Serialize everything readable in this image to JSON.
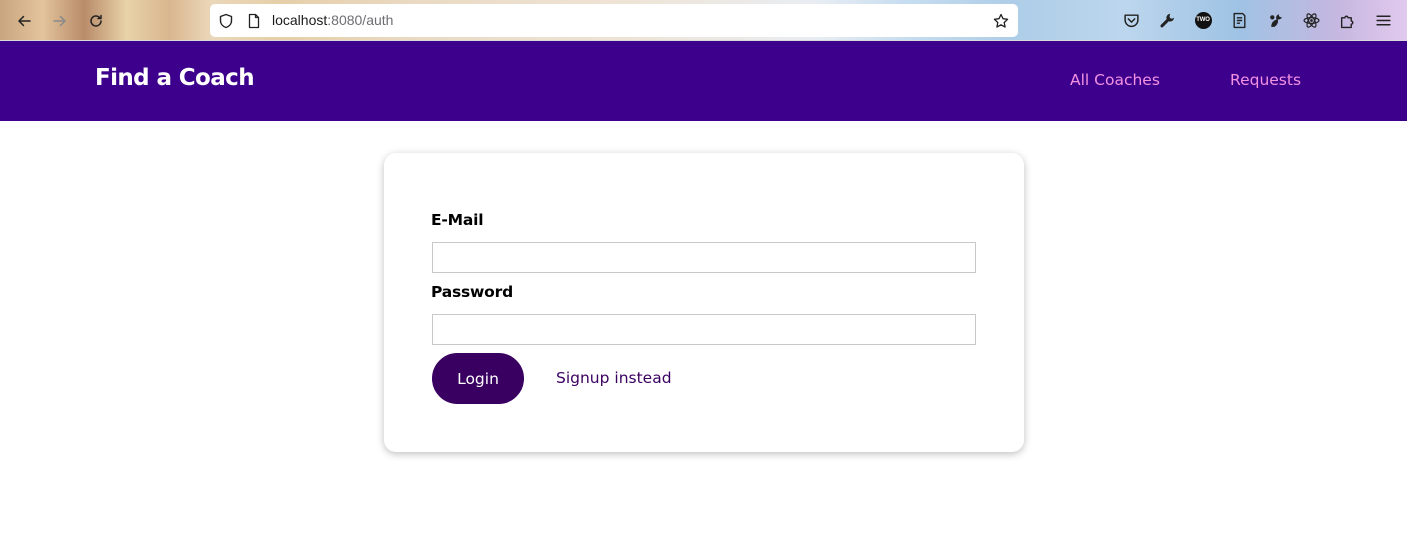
{
  "browser": {
    "url_host": "localhost",
    "url_rest": ":8080/auth",
    "icons": [
      "back-arrow-icon",
      "forward-arrow-icon",
      "reload-icon",
      "shield-icon",
      "page-icon",
      "bookmark-star-icon",
      "pocket-icon",
      "wrench-icon",
      "badge-icon",
      "notes-icon",
      "extension-icon",
      "react-icon",
      "puzzle-icon",
      "menu-icon"
    ],
    "badge_text": "TWO"
  },
  "header": {
    "brand": "Find a Coach",
    "nav": [
      {
        "label": "All Coaches"
      },
      {
        "label": "Requests"
      }
    ]
  },
  "auth_form": {
    "email_label": "E-Mail",
    "email_value": "",
    "password_label": "Password",
    "password_value": "",
    "login_label": "Login",
    "signup_label": "Signup instead"
  },
  "colors": {
    "header_bg": "#3d008d",
    "nav_link": "#f391e3",
    "button_bg": "#3a0061"
  }
}
